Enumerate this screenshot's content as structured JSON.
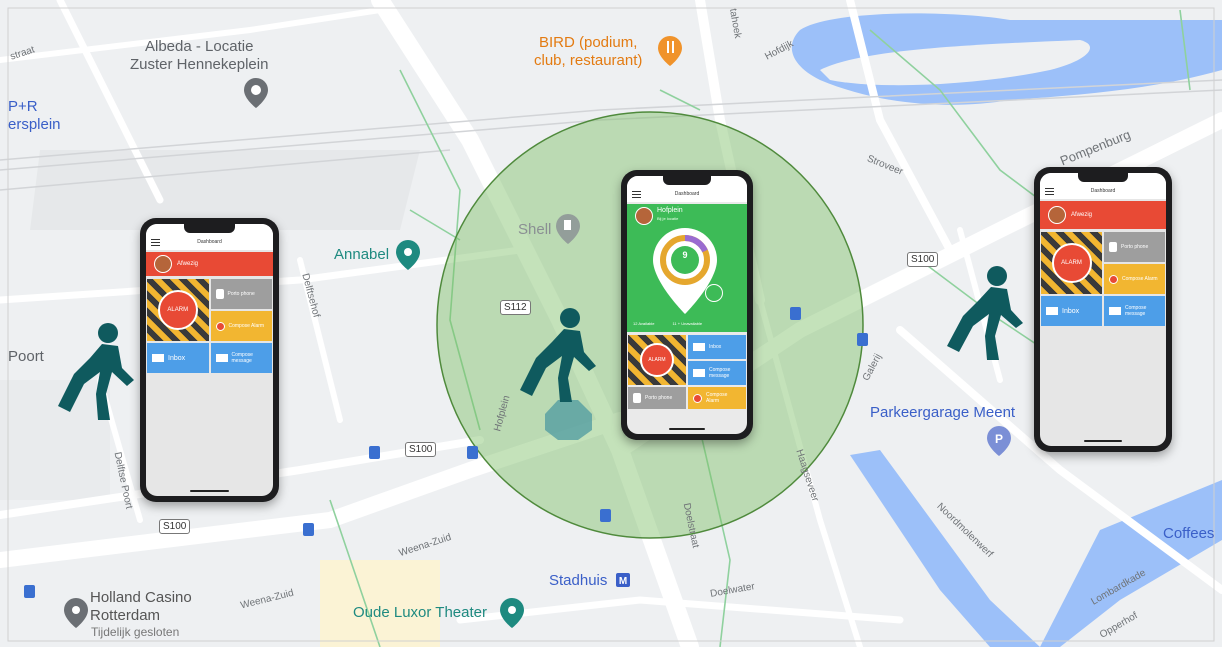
{
  "map": {
    "pois": {
      "albeda": "Albeda - Locatie\nZuster Hennekeplein",
      "bird": "BIRD (podium,\nclub, restaurant)",
      "annabel": "Annabel",
      "shell": "Shell",
      "parkeergarage": "Parkeergarage Meent",
      "stadhuis": "Stadhuis",
      "holland_casino": "Holland Casino\nRotterdam",
      "holland_casino_status": "Tijdelijk gesloten",
      "oude_luxor": "Oude Luxor Theater",
      "coffees": "Coffees",
      "pr": "P+R",
      "pr_cont": "ersplein",
      "poort": "Poort"
    },
    "streets": {
      "hofdijk": "Hofdijk",
      "pompenburg": "Pompenburg",
      "stroveer": "Stroveer",
      "delftsehof": "Delftsehof",
      "hofplein": "Hofplein",
      "delftse_poort": "Delftse Poort",
      "weena_zuid_1": "Weena-Zuid",
      "weena_zuid_2": "Weena-Zuid",
      "galerij": "Galerij",
      "haagseveer": "Haagseveer",
      "doelstraat": "Doelstraat",
      "noordmolenwerf": "Noordmolenwerf",
      "lombardkade": "Lombardkade",
      "doelwater": "Doelwater",
      "opperhof": "Opperhof",
      "straat": "straat",
      "tahoek": "tahoek"
    },
    "shields": [
      "S100",
      "S112",
      "S100",
      "S100"
    ]
  },
  "phones": {
    "left": {
      "header": "Dashboard",
      "status": "Afwezig",
      "alarm": "ALARM",
      "tile_phone": "Porto phone",
      "tile_compose_alarm": "Compose Alarm",
      "tile_inbox": "Inbox",
      "tile_compose_message": "Compose message"
    },
    "center": {
      "header": "Dashboard",
      "location": "Hofplein",
      "location_sub": "Bij je locatie",
      "count": "9",
      "stat_a": "12 Available",
      "stat_b": "11 + Unavailable",
      "alarm": "ALARM",
      "tile_inbox": "Inbox",
      "tile_compose_message": "Compose message",
      "tile_phone": "Porto phone",
      "tile_compose_alarm": "Compose Alarm"
    },
    "right": {
      "header": "Dashboard",
      "status": "Afwezig",
      "alarm": "ALARM",
      "tile_phone": "Porto phone",
      "tile_compose_alarm": "Compose Alarm",
      "tile_inbox": "Inbox",
      "tile_compose_message": "Compose message"
    }
  },
  "colors": {
    "geofence": "#7cbf66",
    "walker": "#0f5a5e",
    "status_red": "#e84a35",
    "alarm_yellow": "#f2b631",
    "tile_blue": "#4d9ee8",
    "center_green": "#3dbb57"
  }
}
